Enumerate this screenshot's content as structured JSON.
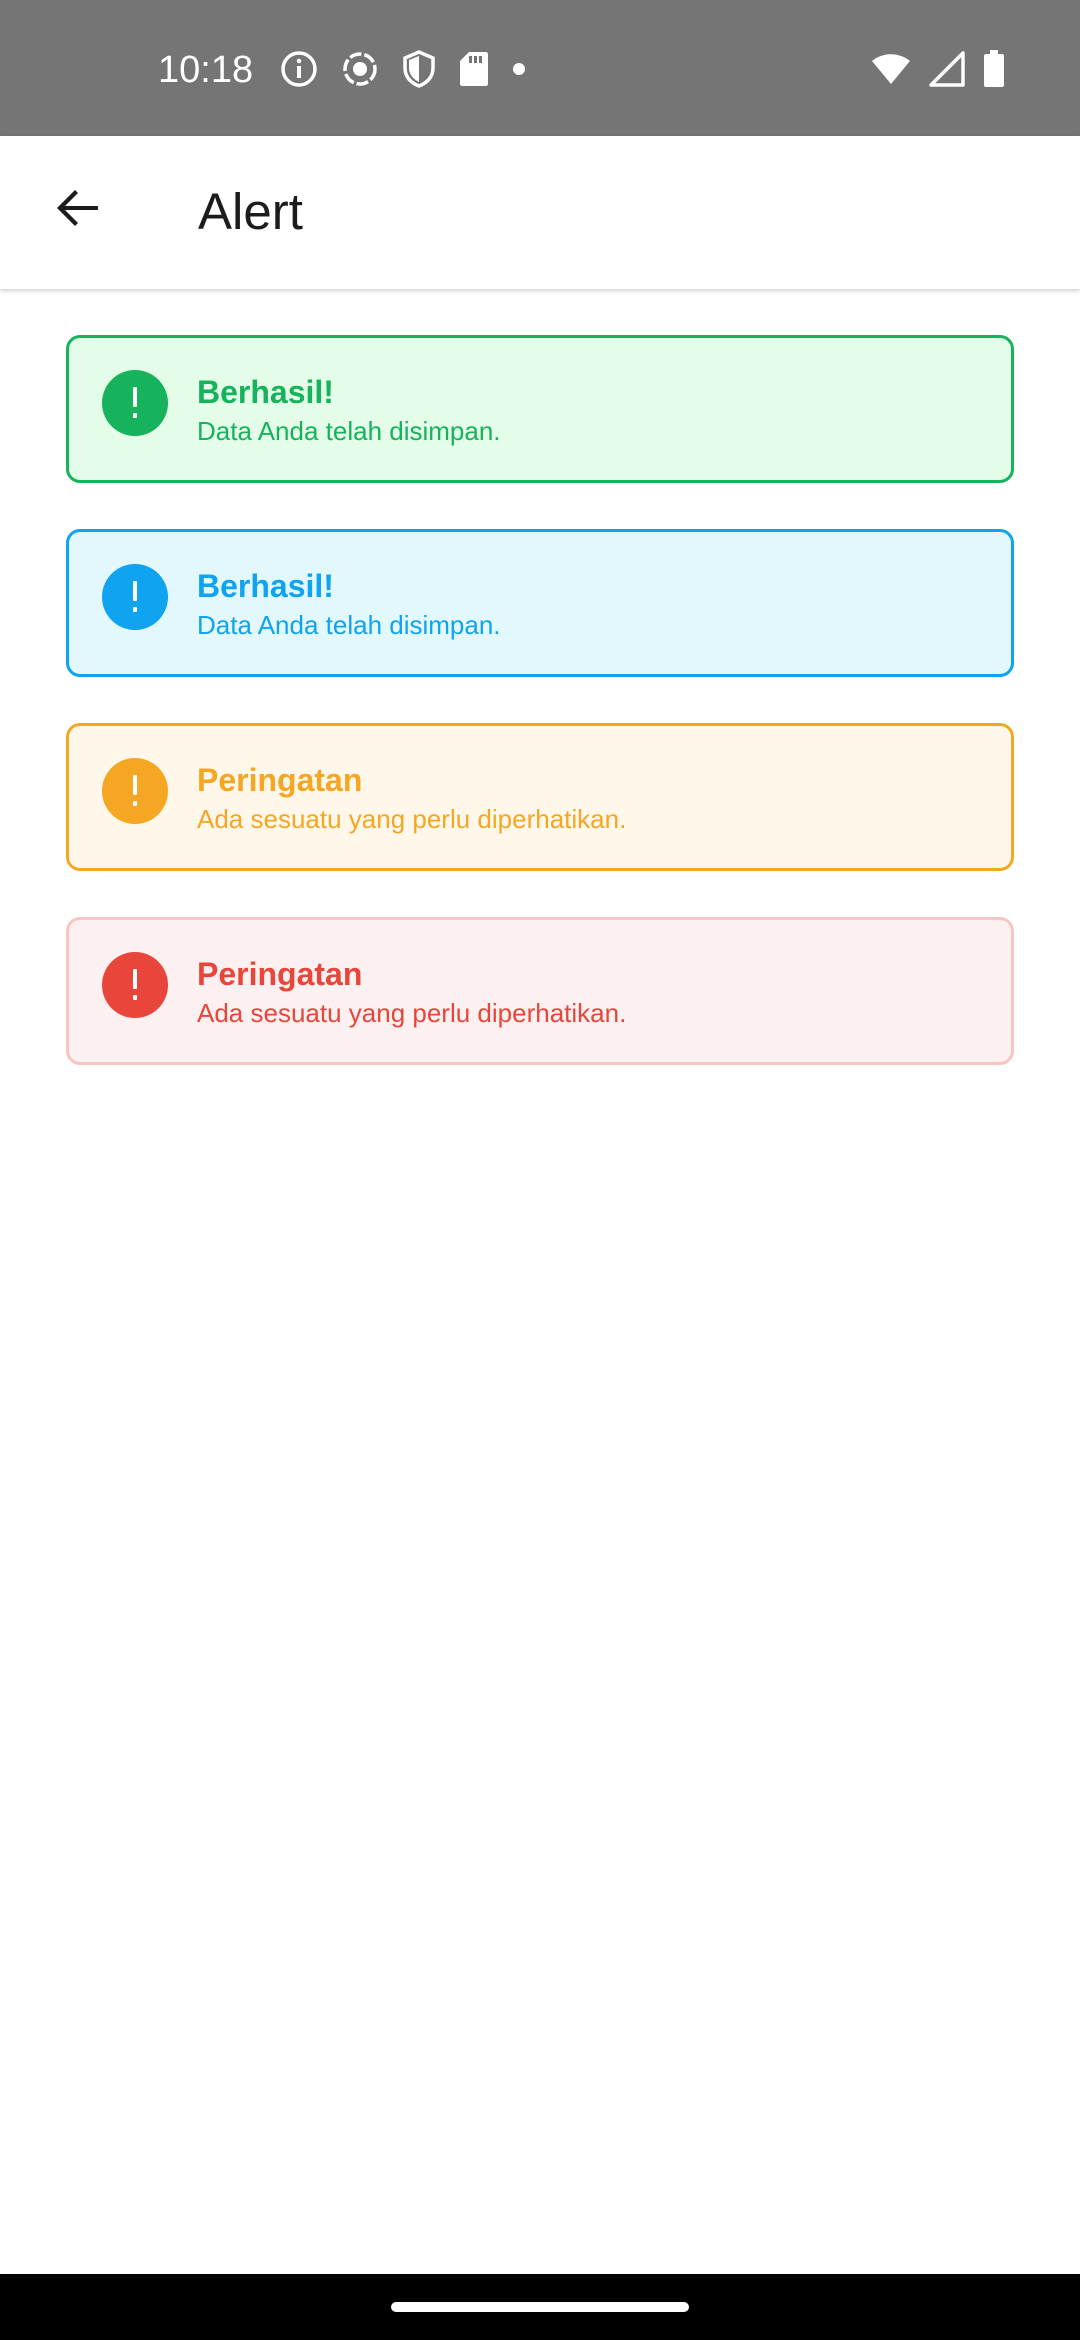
{
  "status_bar": {
    "time": "10:18",
    "icons_left": [
      "info-icon",
      "record-icon",
      "shield-icon",
      "sd-card-icon",
      "dot-icon"
    ],
    "icons_right": [
      "wifi-icon",
      "cellular-signal-icon",
      "battery-icon"
    ]
  },
  "app_bar": {
    "title": "Alert",
    "back_icon": "arrow-back-icon"
  },
  "alerts": [
    {
      "title": "Berhasil!",
      "message": "Data Anda telah disimpan.",
      "icon": "exclamation-circle-icon",
      "colors": {
        "border": "#16b35c",
        "background": "#e4fde9",
        "text": "#16b35c",
        "icon": "#16b35c"
      }
    },
    {
      "title": "Berhasil!",
      "message": "Data Anda telah disimpan.",
      "icon": "exclamation-circle-icon",
      "colors": {
        "border": "#0fa3f0",
        "background": "#e2f8fd",
        "text": "#0fa3f0",
        "icon": "#0fa3f0"
      }
    },
    {
      "title": "Peringatan",
      "message": "Ada sesuatu yang perlu diperhatikan.",
      "icon": "exclamation-circle-icon",
      "colors": {
        "border": "#f5a623",
        "background": "#fff8ea",
        "text": "#f5a623",
        "icon": "#f5a623"
      }
    },
    {
      "title": "Peringatan",
      "message": "Ada sesuatu yang perlu diperhatikan.",
      "icon": "exclamation-circle-icon",
      "colors": {
        "border": "#f8c6c2",
        "background": "#fdf0f0",
        "text": "#e8463b",
        "icon": "#e8463b"
      }
    }
  ],
  "theme": {
    "status_bar_bg": "#757575",
    "app_bar_bg": "#ffffff",
    "title_color": "#1c1c1c",
    "nav_bar_bg": "#000000"
  }
}
